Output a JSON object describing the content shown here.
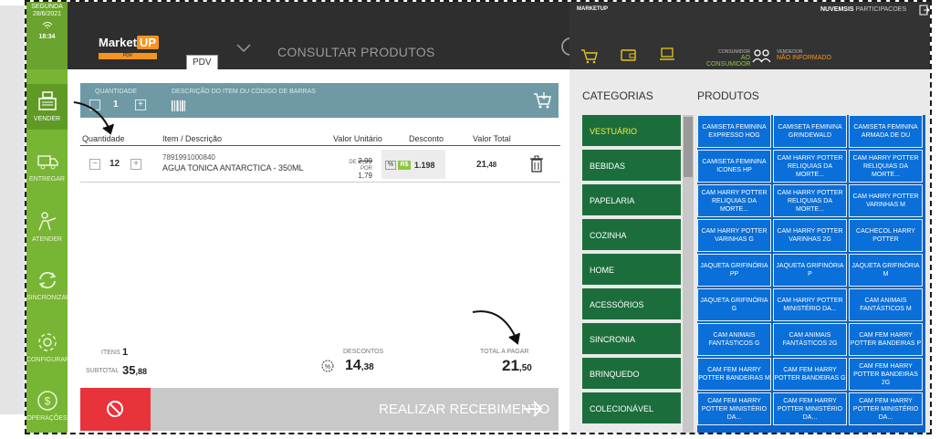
{
  "sidebar": {
    "day": "SEGUNDA",
    "date": "28/6/2021",
    "time": "18:34",
    "items": [
      {
        "label": "VENDER",
        "icon": "cash-register-icon"
      },
      {
        "label": "ENTREGAR",
        "icon": "delivery-truck-icon"
      },
      {
        "label": "ATENDER",
        "icon": "attend-person-icon"
      },
      {
        "label": "SINCRONIZAR",
        "icon": "sync-icon"
      },
      {
        "label": "CONFIGURAR",
        "icon": "gear-icon"
      },
      {
        "label": "OPERAÇÕES",
        "icon": "dollar-icon"
      }
    ]
  },
  "header": {
    "logo_text": "Market",
    "logo_badge": "UP",
    "logo_strip": "PDV",
    "pdv_label": "PDV",
    "title": "CONSULTAR PRODUTOS"
  },
  "quantity_bar": {
    "qty_label": "QUANTIDADE",
    "qty_value": "1",
    "desc_label": "DESCRIÇÃO DO ITEM OU CÓDIGO DE BARRAS"
  },
  "table": {
    "headers": [
      "Quantidade",
      "Item / Descrição",
      "Valor Unitário",
      "Desconto",
      "Valor Total"
    ],
    "rows": [
      {
        "qty": "12",
        "code": "7891991000840",
        "description": "AGUA TONICA ANTARCTICA - 350ML",
        "price_from_label": "DE",
        "price_from": "2,99",
        "price_to_label": "POR",
        "price_to": "1,79",
        "discount_pct": "%",
        "discount_rs": "R$",
        "discount_value": "1.198",
        "total_int": "21",
        "total_dec": ",48"
      }
    ]
  },
  "summary": {
    "items_label": "ITENS",
    "items_value": "1",
    "subtotal_label": "SUBTOTAL",
    "subtotal_int": "35",
    "subtotal_dec": ",88",
    "discounts_label": "DESCONTOS",
    "discounts_int": "14",
    "discounts_dec": ",38",
    "total_label": "TOTAL A PAGAR",
    "total_int": "21",
    "total_dec": ",50"
  },
  "actions": {
    "receive_label": "REALIZAR RECEBIMENTO"
  },
  "right_top": {
    "brand": "MARKETUP",
    "company": "NUVEMSIS",
    "company_suffix": "PARTICIPACOES",
    "consumer_label": "CONSUMIDOR",
    "consumer_value": "AO CONSUMIDOR",
    "seller_label": "VENDEDOR",
    "seller_value": "NÃO INFORMADO"
  },
  "categories": {
    "title": "CATEGORIAS",
    "items": [
      "VESTUÁRIO",
      "BEBIDAS",
      "PAPELARIA",
      "COZINHA",
      "HOME",
      "ACESSÓRIOS",
      "SINCRONIA",
      "BRINQUEDO",
      "COLECIONÁVEL"
    ],
    "selected": "VESTUÁRIO"
  },
  "products": {
    "title": "PRODUTOS",
    "items": [
      "CAMISETA FEMININA EXPRESSO HOG",
      "CAMISETA FEMININA GRINDEWALD",
      "CAMISETA FEMININA ARMADA DE DU",
      "CAMISETA FEMININA ICONES HP",
      "CAM HARRY POTTER RELIQUIAS DA MORTE...",
      "CAM HARRY POTTER RELIQUIAS DA MORTE...",
      "CAM HARRY POTTER RELIQUIAS DA MORTE...",
      "CAM HARRY POTTER RELIQUIAS DA MORTE...",
      "CAM HARRY POTTER VARINHAS M",
      "CAM HARRY POTTER VARINHAS G",
      "CAM HARRY POTTER VARINHAS 2G",
      "CACHECOL HARRY POTTER",
      "JAQUETA GRIFINÓRIA PP",
      "JAQUETA GRIFINÓRIA P",
      "JAQUETA GRIFINÓRIA M",
      "JAQUETA GRIFINÓRIA G",
      "CAM HARRY POTTER MINISTÉRIO DA...",
      "CAM ANIMAIS FANTÁSTICOS M",
      "CAM ANIMAIS FANTÁSTICOS G",
      "CAM ANIMAIS FANTÁSTICOS 2G",
      "CAM FEM HARRY POTTER BANDEIRAS P",
      "CAM FEM HARRY POTTER BANDEIRAS M",
      "CAM FEM HARRY POTTER BANDEIRAS G",
      "CAM FEM HARRY POTTER BANDEIRAS 2G",
      "CAM FEM HARRY POTTER MINISTÉRIO DA...",
      "CAM FEM HARRY POTTER MINISTÉRIO DA...",
      "CAM FEM HARRY POTTER MINISTÉRIO DA..."
    ]
  },
  "colors": {
    "sidebar": "#78b534",
    "category_bg": "#1b6e3c",
    "product_bg": "#0a6fd8",
    "cancel": "#e8333b",
    "accent": "#f7931e"
  }
}
